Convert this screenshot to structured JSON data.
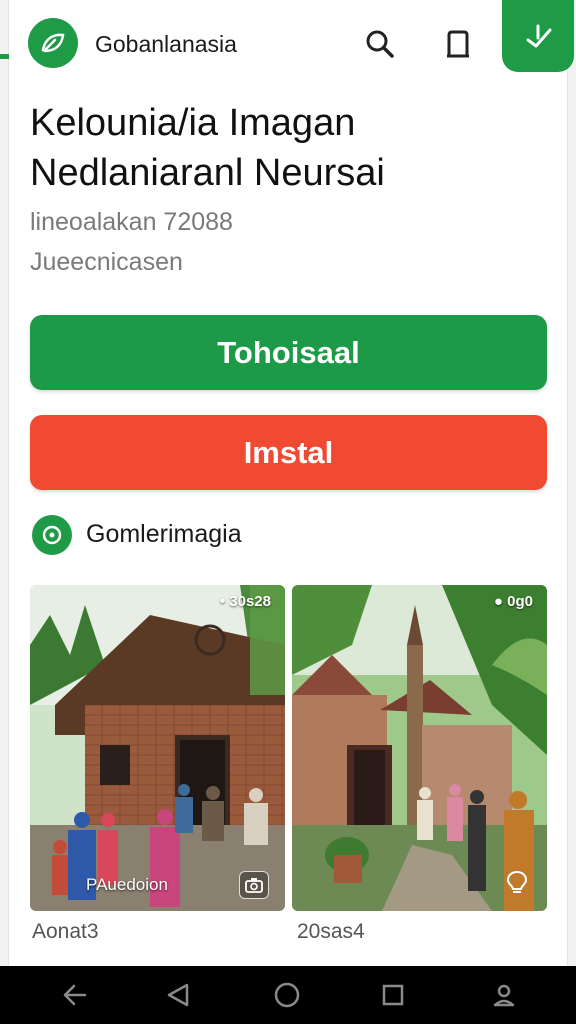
{
  "header": {
    "app_name": "Gobanlanasia"
  },
  "page": {
    "title_line1": "Kelounia/ia Imagan",
    "title_line2": "Nedlaniaranl Neursai",
    "meta_line1": "lineoalakan 72088",
    "meta_line2": "Jueecnicasen"
  },
  "actions": {
    "primary_label": "Tohoisaal",
    "install_label": "Imstal"
  },
  "section": {
    "title": "Gomlerimagia"
  },
  "gallery": [
    {
      "tag": "• 30s28",
      "caption": "PAuedoion",
      "label": "Aonat3"
    },
    {
      "tag": "● 0g0",
      "caption": "",
      "label": "20sas4"
    }
  ],
  "colors": {
    "brand_green": "#1d9a47",
    "install_red": "#f04a33",
    "navbar": "#000000"
  },
  "icons": [
    "leaf-logo-icon",
    "search-icon",
    "bookmark-icon",
    "share-check-icon",
    "circle-dot-icon",
    "camera-icon",
    "lightbulb-icon",
    "back-arrow-icon",
    "triangle-back-icon",
    "home-circle-icon",
    "recent-square-icon",
    "user-icon"
  ]
}
